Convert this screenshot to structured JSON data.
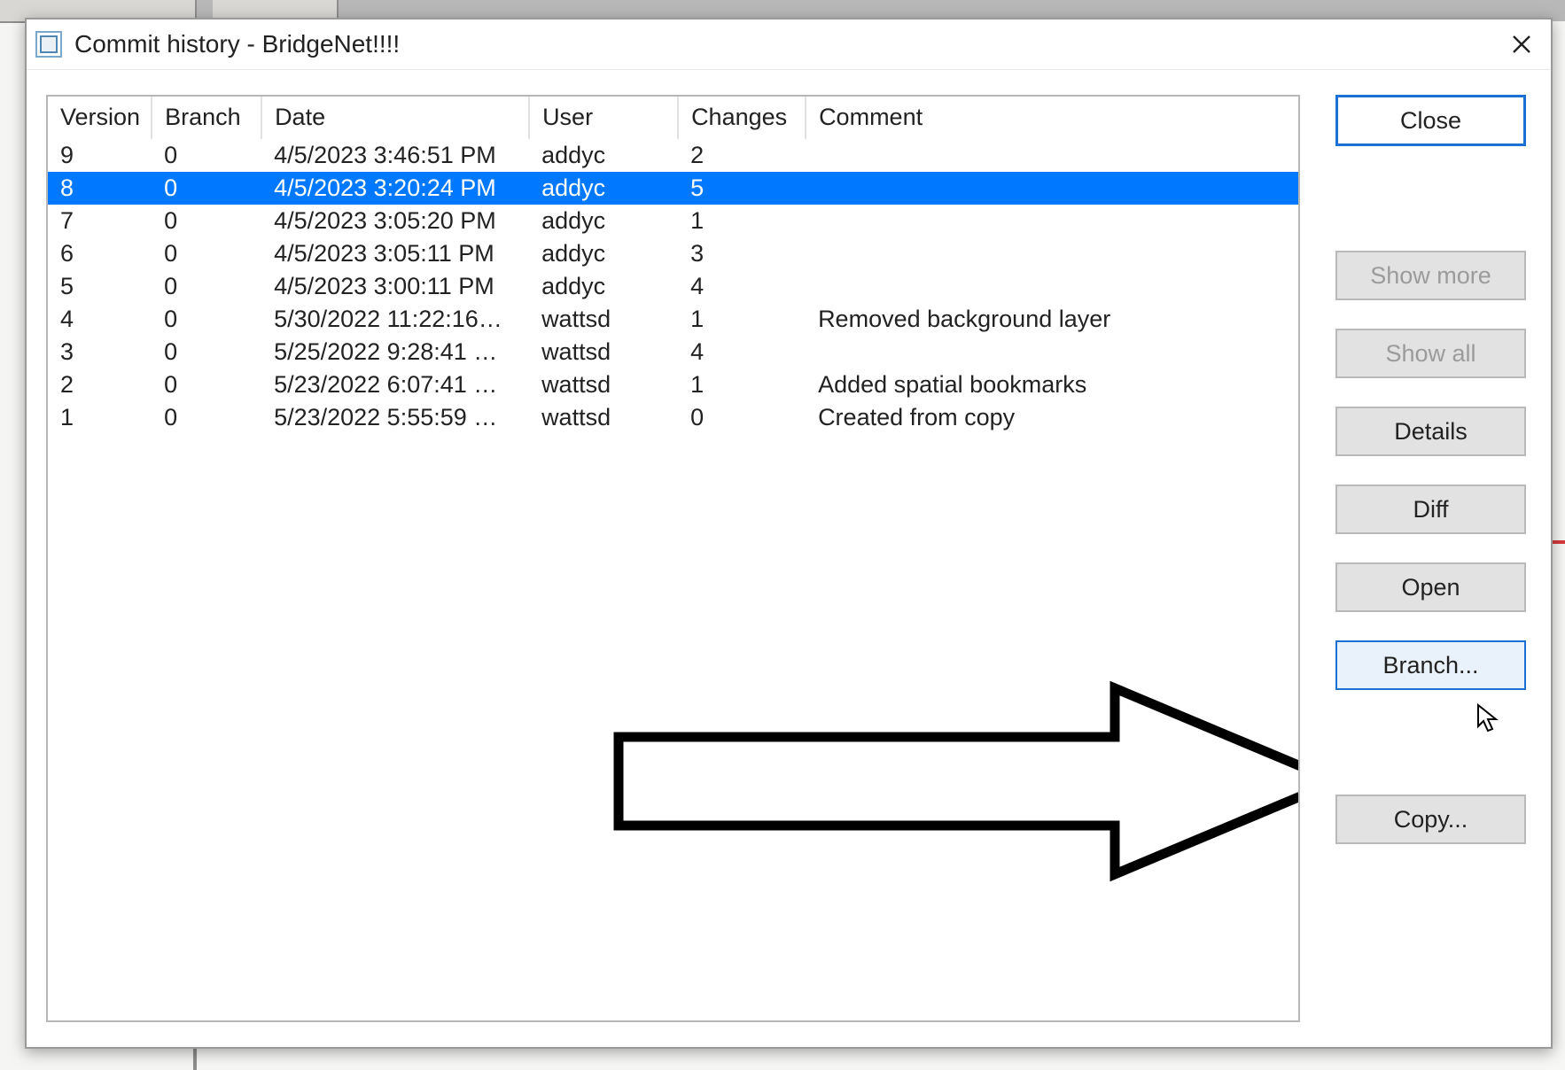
{
  "window": {
    "title": "Commit history - BridgeNet!!!!"
  },
  "table": {
    "headers": {
      "version": "Version",
      "branch": "Branch",
      "date": "Date",
      "user": "User",
      "changes": "Changes",
      "comment": "Comment"
    },
    "rows": [
      {
        "version": "9",
        "branch": "0",
        "date": "4/5/2023 3:46:51 PM",
        "user": "addyc",
        "changes": "2",
        "comment": "",
        "selected": false
      },
      {
        "version": "8",
        "branch": "0",
        "date": "4/5/2023 3:20:24 PM",
        "user": "addyc",
        "changes": "5",
        "comment": "",
        "selected": true
      },
      {
        "version": "7",
        "branch": "0",
        "date": "4/5/2023 3:05:20 PM",
        "user": "addyc",
        "changes": "1",
        "comment": "",
        "selected": false
      },
      {
        "version": "6",
        "branch": "0",
        "date": "4/5/2023 3:05:11 PM",
        "user": "addyc",
        "changes": "3",
        "comment": "",
        "selected": false
      },
      {
        "version": "5",
        "branch": "0",
        "date": "4/5/2023 3:00:11 PM",
        "user": "addyc",
        "changes": "4",
        "comment": "",
        "selected": false
      },
      {
        "version": "4",
        "branch": "0",
        "date": "5/30/2022 11:22:16…",
        "user": "wattsd",
        "changes": "1",
        "comment": "Removed background layer",
        "selected": false
      },
      {
        "version": "3",
        "branch": "0",
        "date": "5/25/2022 9:28:41 …",
        "user": "wattsd",
        "changes": "4",
        "comment": "",
        "selected": false
      },
      {
        "version": "2",
        "branch": "0",
        "date": "5/23/2022 6:07:41 …",
        "user": "wattsd",
        "changes": "1",
        "comment": "Added spatial bookmarks",
        "selected": false
      },
      {
        "version": "1",
        "branch": "0",
        "date": "5/23/2022 5:55:59 …",
        "user": "wattsd",
        "changes": "0",
        "comment": "Created from copy",
        "selected": false
      }
    ]
  },
  "buttons": {
    "close": "Close",
    "show_more": "Show more",
    "show_all": "Show all",
    "details": "Details",
    "diff": "Diff",
    "open": "Open",
    "branch": "Branch...",
    "copy": "Copy..."
  }
}
